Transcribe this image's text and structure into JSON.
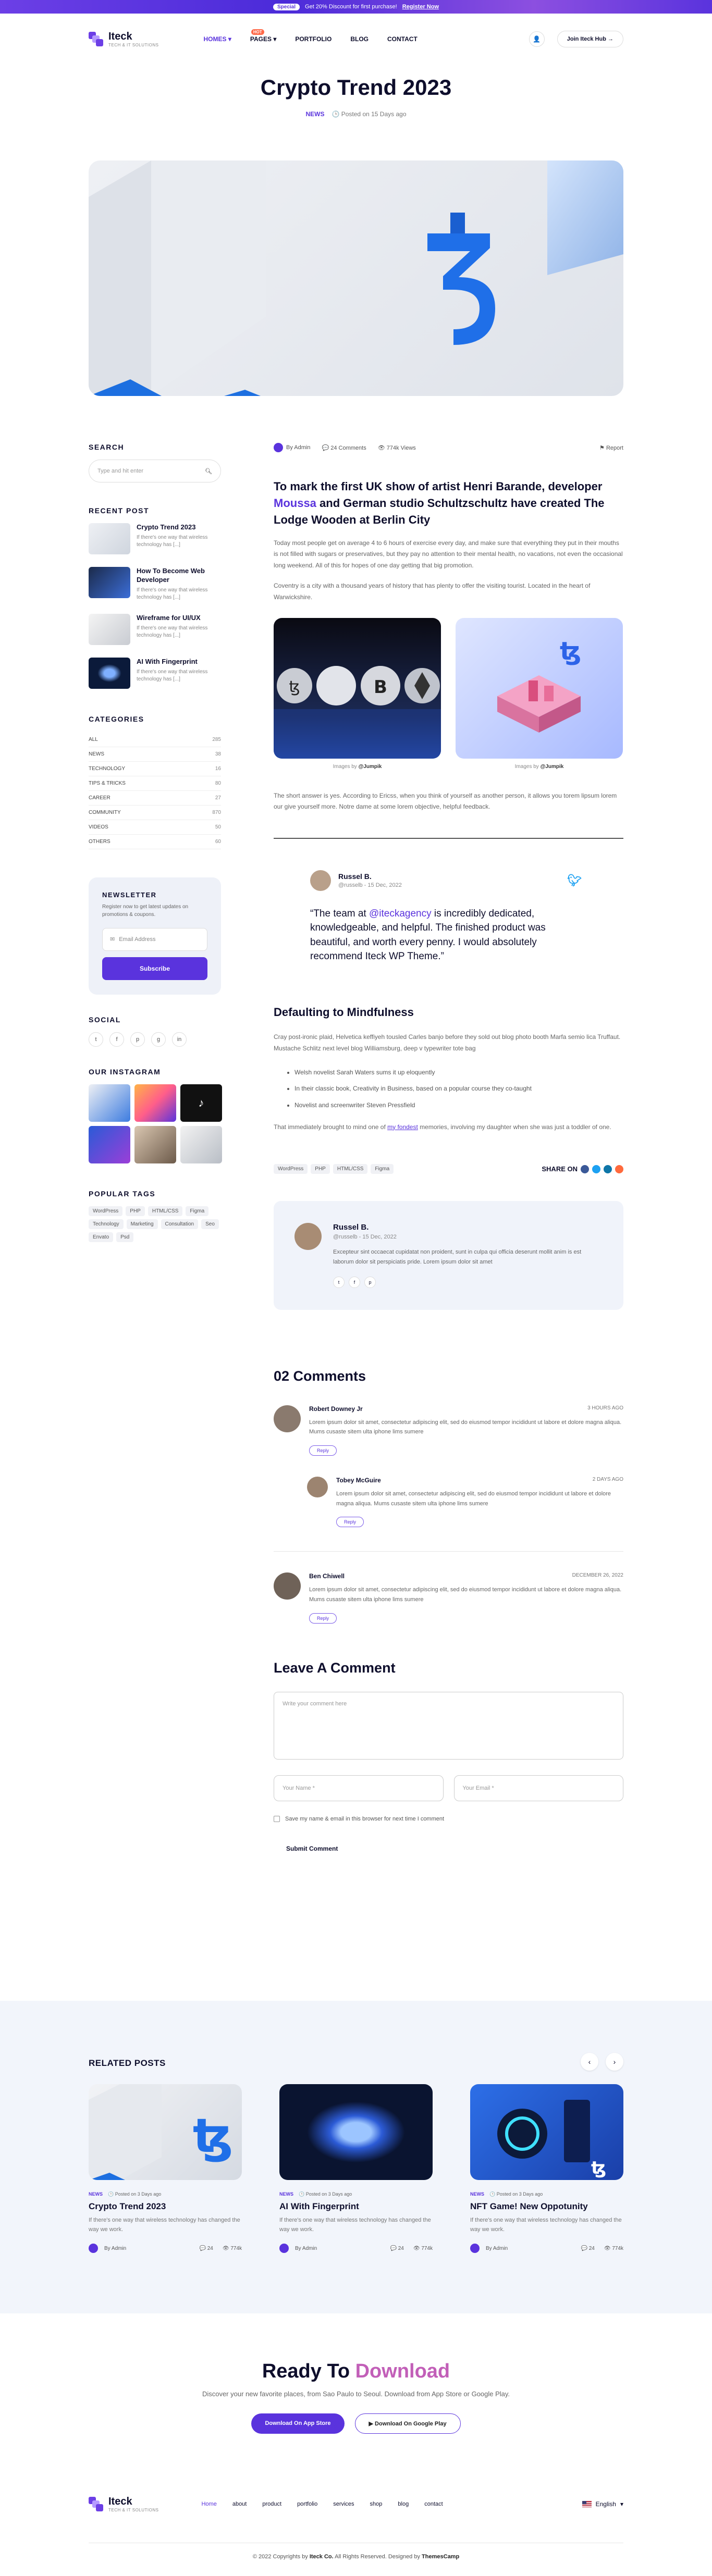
{
  "promo": {
    "pill": "Special",
    "text": "Get 20% Discount for first purchase!",
    "link": "Register Now"
  },
  "header": {
    "logo_name": "Iteck",
    "logo_tag": "TECH & IT SOLUTIONS",
    "nav": [
      {
        "label": "HOMES",
        "active": true
      },
      {
        "label": "PAGES",
        "badge": "HOT"
      },
      {
        "label": "PORTFOLIO"
      },
      {
        "label": "BLOG"
      },
      {
        "label": "CONTACT"
      }
    ],
    "join": "Join Iteck Hub"
  },
  "post": {
    "title": "Crypto Trend 2023",
    "category": "NEWS",
    "posted": "Posted on 15 Days ago",
    "author": "By Admin",
    "comments": "24 Comments",
    "views": "774k Views",
    "report": "Report",
    "lead_a": "To mark the first UK show of artist Henri Barande, developer ",
    "lead_hl": "Moussa",
    "lead_b": " and German studio Schultzschultz have created The Lodge Wooden at Berlin City",
    "p1": "Today most people get on average 4 to 6 hours of exercise every day, and make sure that everything they put in their mouths is not filled with sugars or preservatives, but they pay no attention to their mental health, no vacations, not even the occasional long weekend. All of this for hopes of one day getting that big promotion.",
    "p2": "Coventry is a city with a thousand years of history that has plenty to offer the visiting tourist. Located in the heart of Warwickshire.",
    "cap1_pre": "Images by",
    "cap1": "@Jumpik",
    "cap2_pre": "Images by",
    "cap2": "@Jumpik",
    "p3": "The short answer is yes. According to Ericss, when you think of yourself as another person, it allows you torem lipsum lorem our give yourself more. Notre dame at some lorem objective, helpful feedback.",
    "quote_name": "Russel B.",
    "quote_handle": "@russelb - 15 Dec, 2022",
    "quote_a": "“The team at ",
    "quote_hl": "@iteckagency",
    "quote_b": " is incredibly dedicated, knowledgeable, and helpful. The finished product was beautiful, and worth every penny. I would absolutely recommend Iteck WP Theme.”",
    "h2": "Defaulting to Mindfulness",
    "p4": "Cray post-ironic plaid, Helvetica keffiyeh tousled Carles banjo before they sold out blog photo booth Marfa semio lica Truffaut. Mustache Schlitz next level blog Williamsburg, deep v typewriter tote bag",
    "bullets": [
      "Welsh novelist Sarah Waters sums it up eloquently",
      "In their classic book, Creativity in Business, based on a popular course they co-taught",
      "Novelist and screenwriter Steven Pressfield"
    ],
    "p5_a": "That immediately brought to mind one of ",
    "p5_link": "my fondest",
    "p5_b": " memories, involving my daughter when she was just a toddler of one.",
    "tags": [
      "WordPress",
      "PHP",
      "HTML/CSS",
      "Figma"
    ],
    "share": "SHARE ON",
    "author_name": "Russel B.",
    "author_handle": "@russelb - 15 Dec, 2022",
    "author_bio": "Excepteur sint occaecat cupidatat non proident, sunt in culpa qui officia deserunt mollit anim is est laborum dolor sit perspiciatis pride. Lorem ipsum dolor sit amet",
    "comment_title": "02 Comments",
    "comments_list": [
      {
        "name": "Robert Downey Jr",
        "time": "3 HOURS AGO",
        "text": "Lorem ipsum dolor sit amet, consectetur adipiscing elit, sed do eiusmod tempor incididunt ut labore et dolore magna aliqua. Mums cusaste sitem ulta iphone lims sumere",
        "reply": "Reply"
      },
      {
        "name": "Tobey McGuire",
        "time": "2 DAYS AGO",
        "text": "Lorem ipsum dolor sit amet, consectetur adipiscing elit, sed do eiusmod tempor incididunt ut labore et dolore magna aliqua. Mums cusaste sitem ulta iphone lims sumere",
        "reply": "Reply"
      },
      {
        "name": "Ben Chiwell",
        "time": "DECEMBER 26, 2022",
        "text": "Lorem ipsum dolor sit amet, consectetur adipiscing elit, sed do eiusmod tempor incididunt ut labore et dolore magna aliqua. Mums cusaste sitem ulta iphone lims sumere",
        "reply": "Reply"
      }
    ],
    "leave_title": "Leave A Comment",
    "textarea_ph": "Write your comment here",
    "name_ph": "Your Name *",
    "email_ph": "Your Email *",
    "save_label": "Save my name & email in this browser for next time I comment",
    "submit": "Submit Comment"
  },
  "sidebar": {
    "search_h": "SEARCH",
    "search_ph": "Type and hit enter",
    "recent_h": "RECENT POST",
    "recent": [
      {
        "title": "Crypto Trend 2023",
        "desc": "If there's one way that wireless technology has [...]"
      },
      {
        "title": "How To Become Web Developer",
        "desc": "If there's one way that wireless technology has [...]"
      },
      {
        "title": "Wireframe for UI/UX",
        "desc": "If there's one way that wireless technology has [...]"
      },
      {
        "title": "AI With Fingerprint",
        "desc": "If there's one way that wireless technology has [...]"
      }
    ],
    "categories_h": "CATEGORIES",
    "categories": [
      {
        "name": "ALL",
        "count": "285"
      },
      {
        "name": "NEWS",
        "count": "38"
      },
      {
        "name": "TECHNOLOGY",
        "count": "16"
      },
      {
        "name": "TIPS & TRICKS",
        "count": "80"
      },
      {
        "name": "CAREER",
        "count": "27"
      },
      {
        "name": "COMMUNITY",
        "count": "870"
      },
      {
        "name": "VIDEOS",
        "count": "50"
      },
      {
        "name": "OTHERS",
        "count": "60"
      }
    ],
    "newsletter_h": "NEWSLETTER",
    "newsletter_p": "Register now to get latest updates on promotions & coupons.",
    "email_ph": "Email Address",
    "subscribe": "Subscribe",
    "social_h": "SOCIAL",
    "social": [
      "t",
      "f",
      "p",
      "g",
      "in"
    ],
    "insta_h": "OUR INSTAGRAM",
    "tags_h": "POPULAR TAGS",
    "tags": [
      "WordPress",
      "PHP",
      "HTML/CSS",
      "Figma",
      "Technology",
      "Marketing",
      "Consultation",
      "Seo",
      "Envato",
      "Psd"
    ]
  },
  "related": {
    "heading": "RELATED POSTS",
    "cards": [
      {
        "cat": "NEWS",
        "date": "Posted on 3 Days ago",
        "title": "Crypto Trend 2023",
        "desc": "If there's one way that wireless technology has changed the way we work.",
        "author": "By Admin",
        "comments": "24",
        "views": "774k"
      },
      {
        "cat": "NEWS",
        "date": "Posted on 3 Days ago",
        "title": "AI With Fingerprint",
        "desc": "If there's one way that wireless technology has changed the way we work.",
        "author": "By Admin",
        "comments": "24",
        "views": "774k"
      },
      {
        "cat": "NEWS",
        "date": "Posted on 3 Days ago",
        "title": "NFT Game! New Oppotunity",
        "desc": "If there's one way that wireless technology has changed the way we work.",
        "author": "By Admin",
        "comments": "24",
        "views": "774k"
      }
    ]
  },
  "cta": {
    "title_a": "Ready To ",
    "title_b": "Download",
    "desc": "Discover your new favorite places, from Sao Paulo to Seoul. Download from App Store or Google Play.",
    "app_store": "Download On App Store",
    "google_play": "Download On Google Play"
  },
  "footer": {
    "logo_name": "Iteck",
    "logo_tag": "TECH & IT SOLUTIONS",
    "nav": [
      "Home",
      "about",
      "product",
      "portfolio",
      "services",
      "shop",
      "blog",
      "contact"
    ],
    "lang": "English",
    "copy_a": "© 2022 Copyrights by ",
    "copy_brand": "Iteck Co.",
    "copy_b": " All Rights Reserved. Designed by ",
    "copy_designer": "ThemesCamp"
  }
}
